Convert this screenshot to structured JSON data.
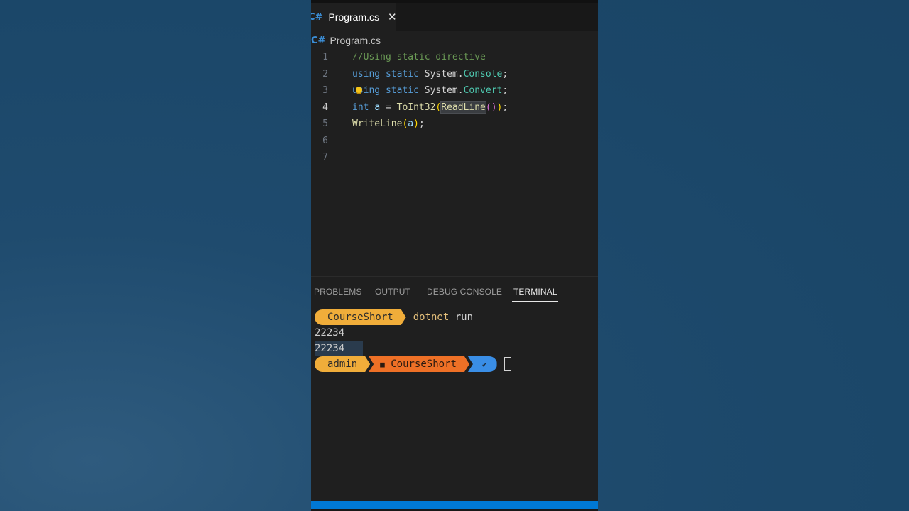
{
  "tab": {
    "icon": "C#",
    "label": "Program.cs",
    "close": "✕"
  },
  "breadcrumb": {
    "icon": "C#",
    "label": "Program.cs"
  },
  "code": {
    "line_numbers": [
      "1",
      "2",
      "3",
      "4",
      "5",
      "6",
      "7"
    ],
    "line1": {
      "comment": "//Using static directive"
    },
    "line2": {
      "kw1": "using",
      "kw2": "static",
      "ns": "System",
      "dot": ".",
      "type": "Console",
      "semi": ";"
    },
    "line3": {
      "kw1": "using",
      "kw2": "static",
      "ns": "System",
      "dot": ".",
      "type": "Convert",
      "semi": ";"
    },
    "line4": {
      "kw": "int",
      "var": "a",
      "eq": " = ",
      "fn": "ToInt32",
      "p1": "(",
      "fn2": "ReadLine",
      "p2": "()",
      "p3": ")",
      "semi": ";"
    },
    "line5": {
      "fn": "WriteLine",
      "p1": "(",
      "var": "a",
      "p2": ")",
      "semi": ";"
    }
  },
  "panel": {
    "tabs": [
      "PROBLEMS",
      "OUTPUT",
      "DEBUG CONSOLE",
      "TERMINAL"
    ],
    "active_tab": "TERMINAL"
  },
  "terminal": {
    "prompt1_dir": "CourseShort",
    "command": "dotnet",
    "command_arg": "run",
    "output1": "22234",
    "output2": "22234",
    "prompt2_user": "admin",
    "prompt2_folder_icon": "folder-icon",
    "prompt2_dir": "CourseShort",
    "prompt2_status": "✔"
  },
  "colors": {
    "accent": "#0078d4",
    "prompt_yellow": "#f0ad3a",
    "prompt_orange": "#ee7026",
    "prompt_blue": "#3a8ee6"
  }
}
